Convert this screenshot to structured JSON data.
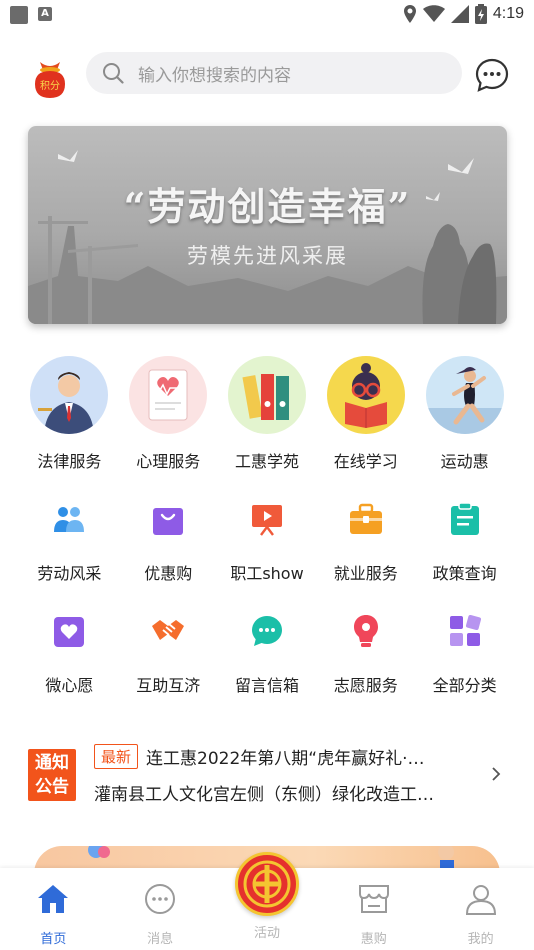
{
  "status_bar": {
    "time": "4:19"
  },
  "header": {
    "logo_text": "积分",
    "search_placeholder": "输入你想搜索的内容"
  },
  "banner": {
    "title": "“劳动创造幸福”",
    "subtitle": "劳模先进风采展"
  },
  "services_main": [
    {
      "label": "法律服务",
      "icon": "lawyer-icon"
    },
    {
      "label": "心理服务",
      "icon": "heart-report-icon"
    },
    {
      "label": "工惠学苑",
      "icon": "binders-icon"
    },
    {
      "label": "在线学习",
      "icon": "reader-icon"
    },
    {
      "label": "运动惠",
      "icon": "runner-icon"
    }
  ],
  "services_row2": [
    {
      "label": "劳动风采",
      "icon": "workers-icon",
      "color": "#2f8fe6"
    },
    {
      "label": "优惠购",
      "icon": "shopping-bag-icon",
      "color": "#8e5be6"
    },
    {
      "label": "职工show",
      "icon": "presentation-icon",
      "color": "#f05a3a"
    },
    {
      "label": "就业服务",
      "icon": "briefcase-icon",
      "color": "#f5a023"
    },
    {
      "label": "政策查询",
      "icon": "clipboard-icon",
      "color": "#1bbfa8"
    }
  ],
  "services_row3": [
    {
      "label": "微心愿",
      "icon": "heart-card-icon",
      "color": "#8e5be6"
    },
    {
      "label": "互助互济",
      "icon": "handshake-icon",
      "color": "#f56d2d"
    },
    {
      "label": "留言信箱",
      "icon": "chat-bubble-icon",
      "color": "#1bbfa8"
    },
    {
      "label": "志愿服务",
      "icon": "lightbulb-icon",
      "color": "#f0465a"
    },
    {
      "label": "全部分类",
      "icon": "grid-icon",
      "color": "#8e5be6"
    }
  ],
  "notice": {
    "badge_line1": "通知",
    "badge_line2": "公告",
    "tag": "最新",
    "line1": "连工惠2022年第八期“虎年赢好礼·…",
    "line2": "灌南县工人文化宫左侧（东侧）绿化改造工…"
  },
  "tabbar": {
    "home": "首页",
    "messages": "消息",
    "activity": "活动",
    "deals": "惠购",
    "mine": "我的"
  },
  "colors": {
    "accent": "#2f6bd8",
    "notice": "#f2541b",
    "emblem": "#e5312d"
  }
}
